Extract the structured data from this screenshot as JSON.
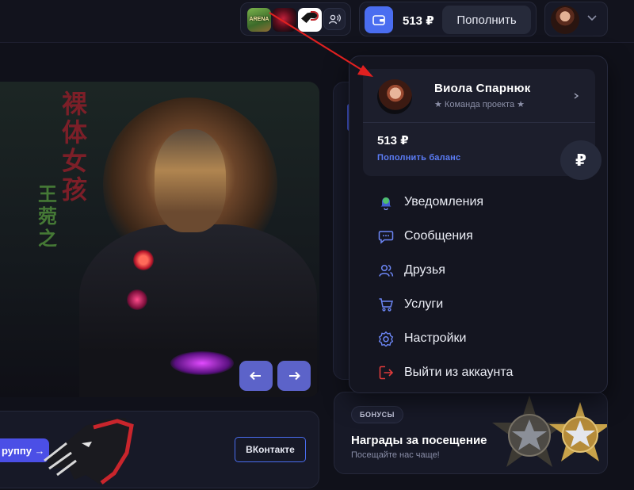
{
  "header": {
    "servers": [
      {
        "label": "ARENA"
      },
      {
        "label": ""
      },
      {
        "label": ""
      }
    ],
    "balance": "513 ₽",
    "topup_label": "Пополнить"
  },
  "hero": {
    "neon_top": "裸\n体\n女\n孩",
    "neon_mid": "王\n菀\n之"
  },
  "group_card": {
    "join_label": "руппу →",
    "vk_label": "ВКонтакте"
  },
  "bonus": {
    "badge": "БОНУСЫ",
    "title": "Награды за посещение",
    "subtitle": "Посещайте нас чаще!"
  },
  "dropdown": {
    "user_name": "Виола Спарнюк",
    "user_role": "★ Команда проекта ★",
    "balance": "513 ₽",
    "topup_link": "Пополнить баланс",
    "currency_symbol": "₽",
    "menu": [
      {
        "label": "Уведомления",
        "icon": "bell-icon"
      },
      {
        "label": "Сообщения",
        "icon": "chat-icon"
      },
      {
        "label": "Друзья",
        "icon": "friends-icon"
      },
      {
        "label": "Услуги",
        "icon": "cart-icon"
      },
      {
        "label": "Настройки",
        "icon": "gear-icon"
      },
      {
        "label": "Выйти из аккаунта",
        "icon": "logout-icon"
      }
    ]
  },
  "colors": {
    "accent": "#4a6df0",
    "logout": "#e03b3b",
    "annotation_arrow": "#e02020"
  }
}
